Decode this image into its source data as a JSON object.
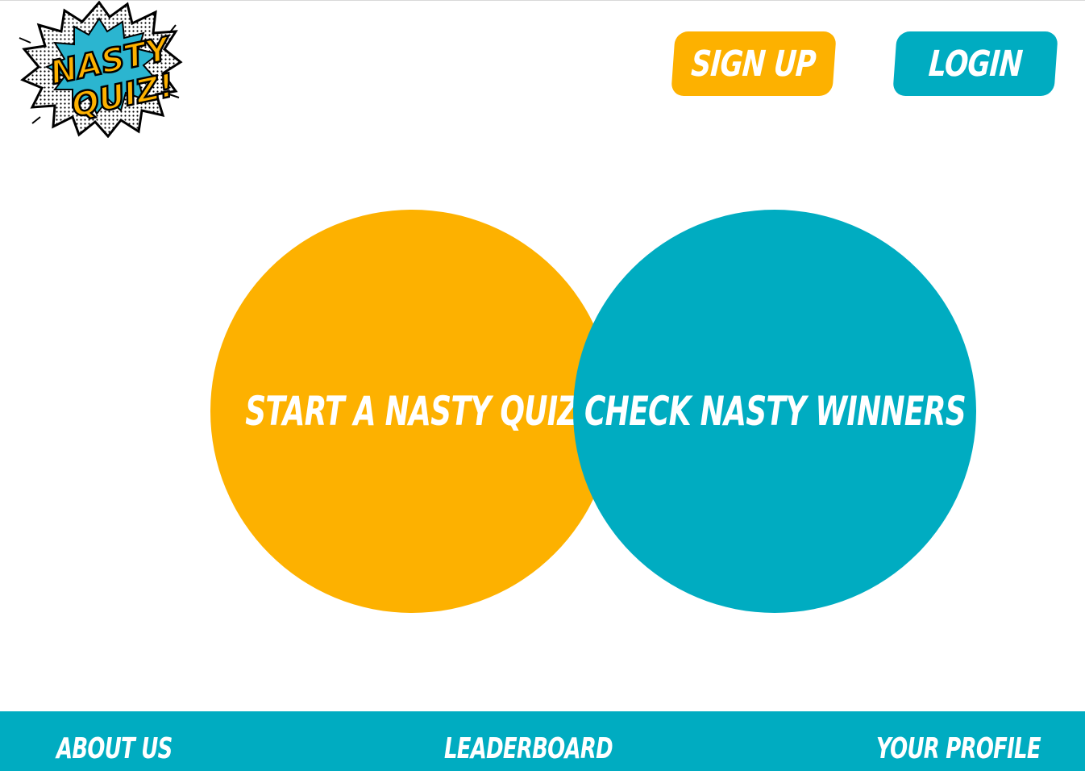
{
  "logo": {
    "line1": "NASTY",
    "line2": "QUIZ!",
    "colors": {
      "fill": "#FDB100",
      "burst": "#2BB5D0",
      "outline": "#000000"
    }
  },
  "header": {
    "signup_label": "SIGN UP",
    "login_label": "LOGIN"
  },
  "main": {
    "start_quiz_label": "START A NASTY QUIZ",
    "check_winners_label": "CHECK NASTY WINNERS"
  },
  "footer": {
    "about_label": "ABOUT US",
    "leaderboard_label": "LEADERBOARD",
    "profile_label": "YOUR PROFILE"
  },
  "colors": {
    "accent_yellow": "#FDB100",
    "accent_teal": "#00ACC1",
    "text_light": "#FFFFFF"
  }
}
